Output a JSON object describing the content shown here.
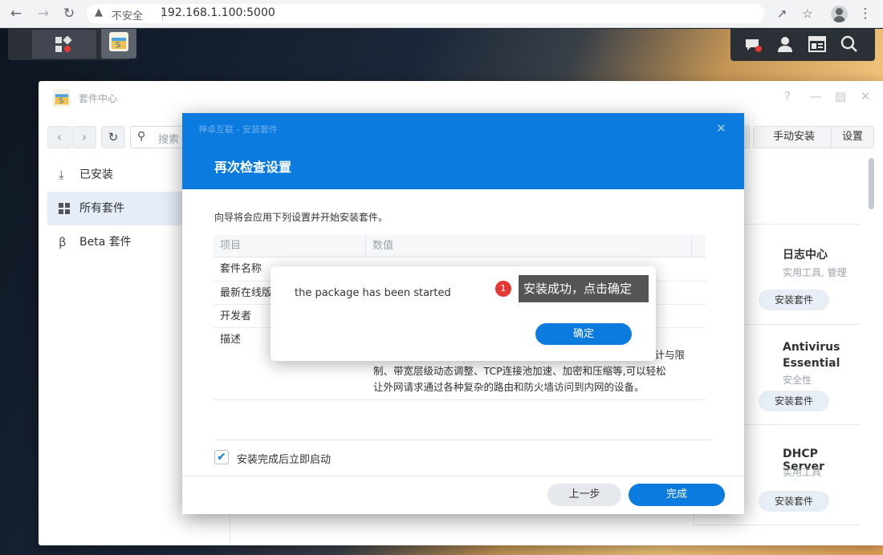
{
  "browser": {
    "insecure_label": "不安全",
    "url": "192.168.1.100:5000"
  },
  "package_center": {
    "title": "套件中心",
    "search_placeholder": "搜索",
    "manual_install": "手动安装",
    "settings": "设置",
    "sidebar": [
      {
        "label": "已安装",
        "icon": "download-icon"
      },
      {
        "label": "所有套件",
        "icon": "grid-icon"
      },
      {
        "label": "Beta 套件",
        "icon": "beta-icon"
      }
    ],
    "cards": [
      {
        "name": "日志中心",
        "category": "实用工具, 管理",
        "button": "安装套件"
      },
      {
        "name": "Antivirus Essential",
        "category": "安全性",
        "button": "安装套件"
      },
      {
        "name": "DHCP Server",
        "category": "实用工具",
        "button": "安装套件"
      }
    ]
  },
  "install_dialog": {
    "subtitle": "神卓互联 - 安装套件",
    "title": "再次检查设置",
    "intro": "向导将会应用下列设置并开始安装套件。",
    "col_item": "项目",
    "col_value": "数值",
    "rows": [
      "套件名称",
      "最新在线版",
      "开发者",
      "描述"
    ],
    "desc_line1": "计与限",
    "desc_line2": "制、带宽层级动态调整、TCP连接池加速、加密和压缩等,可以轻松",
    "desc_line3": "让外网请求通过各种复杂的路由和防火墙访问到内网的设备。",
    "start_after_install": "安装完成后立即启动",
    "start_checked": true,
    "prev": "上一步",
    "finish": "完成"
  },
  "message": {
    "text": "the package has been started",
    "ok": "确定"
  },
  "annotation": {
    "number": "1",
    "text": "安装成功，点击确定"
  },
  "colors": {
    "accent": "#0b7be0",
    "badge_red": "#e53935"
  }
}
